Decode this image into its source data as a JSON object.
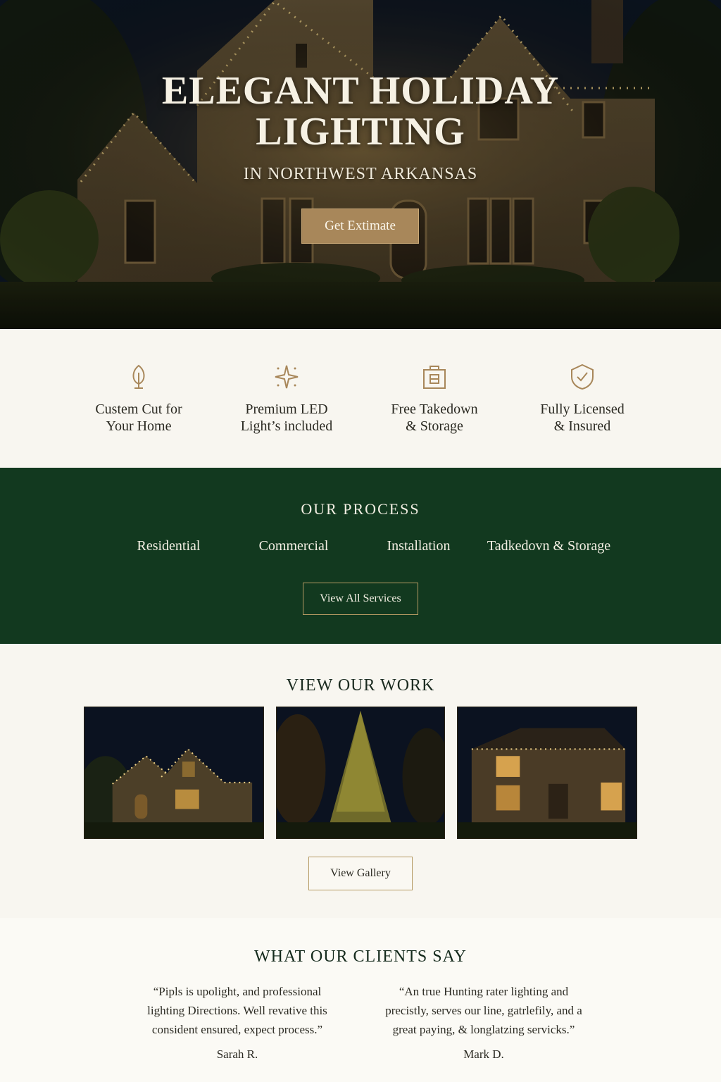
{
  "hero": {
    "title_line1": "ELEGANT HOLIDAY",
    "title_line2": "LIGHTING",
    "subtitle": "IN NORTHWEST ARKANSAS",
    "cta_label": "Get Extimate"
  },
  "features": [
    {
      "icon": "tree-icon",
      "line1": "Custem Cut for",
      "line2": "Your Home"
    },
    {
      "icon": "sparkle-icon",
      "line1": "Premium LED",
      "line2": "Light’s included"
    },
    {
      "icon": "storage-box-icon",
      "line1": "Free Takedown",
      "line2": "& Storage"
    },
    {
      "icon": "shield-check-icon",
      "line1": "Fully Licensed",
      "line2": "& Insured"
    }
  ],
  "process": {
    "title": "OUR PROCESS",
    "tabs": [
      "Residential",
      "Commercial",
      "Installation",
      "Tadkedovn & Storage"
    ],
    "button_label": "View All Services"
  },
  "work": {
    "title": "VIEW OUR WORK",
    "button_label": "View Gallery"
  },
  "testimonials": {
    "title": "WHAT OUR CLIENTS SAY",
    "items": [
      {
        "quote": "“Pipls is upolight, and professional lighting Directions. Well revative this consident ensured, expect process.”",
        "name": "Sarah R."
      },
      {
        "quote": "“An true Hunting rater lighting and precistly, serves our line, gatrlefily, and a great paying, & longlatzing servicks.”",
        "name": "Mark D."
      }
    ]
  },
  "colors": {
    "accent_gold": "#a8875a",
    "forest_green": "#12391f",
    "cream": "#f8f6f0"
  }
}
